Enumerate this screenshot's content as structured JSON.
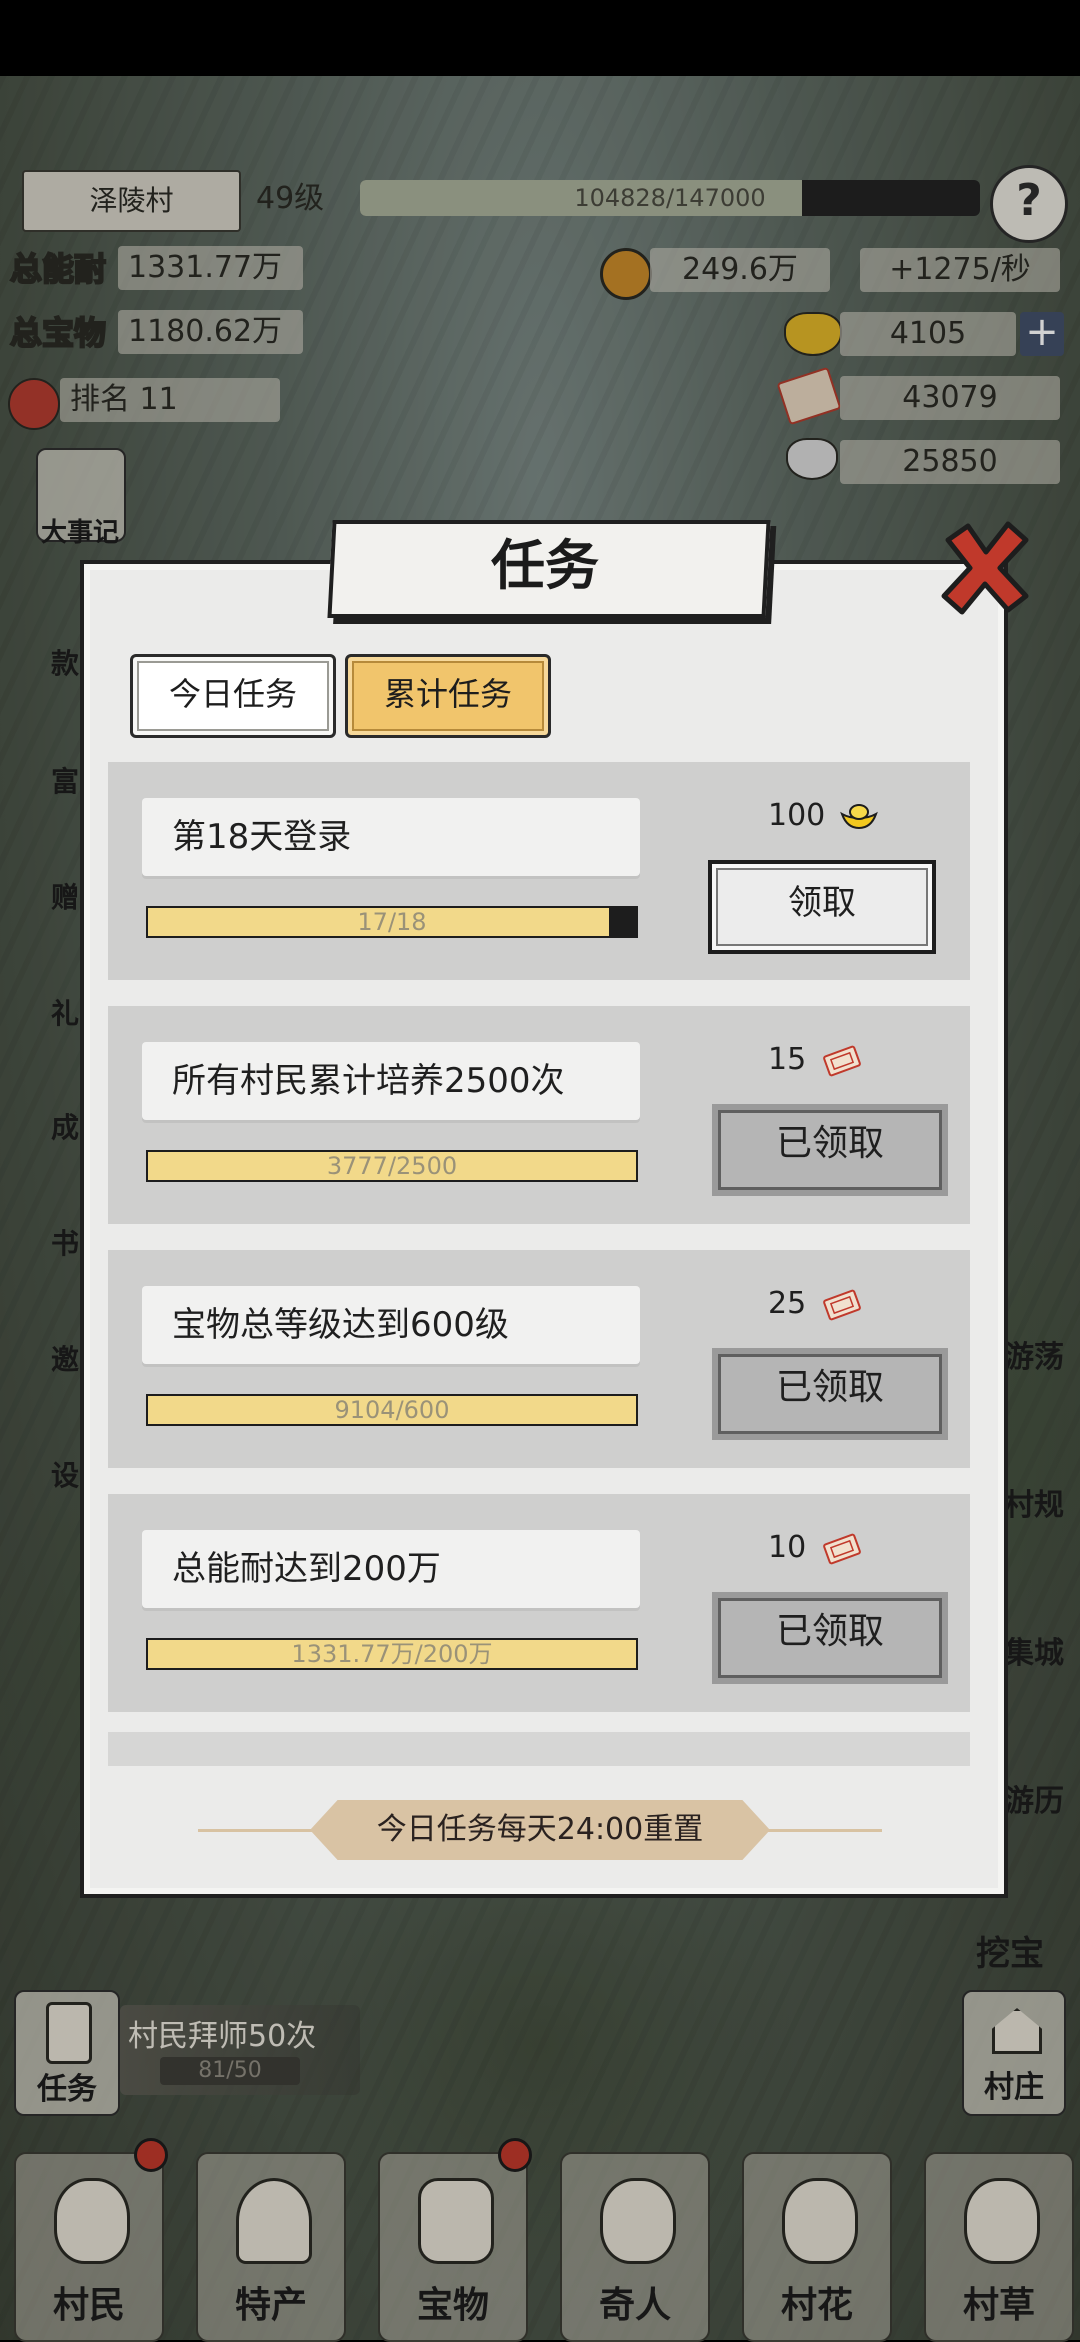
{
  "hud": {
    "village": "泽陵村",
    "level": "49级",
    "xp": "104828/147000",
    "xp_progress": 0.713,
    "help": "?",
    "total_endurance_label": "总能耐",
    "total_endurance": "1331.77万",
    "total_wealth_label": "总宝物",
    "total_wealth": "1180.62万",
    "rank": "排名 11",
    "coins": "249.6万",
    "coins_rate": "+1275/秒",
    "gold_ingots": "4105",
    "tickets": "43079",
    "silver": "25850",
    "plus": "+"
  },
  "left_side": [
    "大事记",
    "款",
    "富",
    "赠",
    "礼",
    "成",
    "书",
    "邀",
    "设"
  ],
  "right_side": [
    "游荡",
    "村规",
    "集城",
    "游历",
    "挖宝"
  ],
  "dialog": {
    "title": "任务",
    "tabs": [
      "今日任务",
      "累计任务"
    ],
    "active_tab": 1,
    "tasks": [
      {
        "title": "第18天登录",
        "progress_text": "17/18",
        "progress": 0.944,
        "reward": "100",
        "reward_icon": "gold-ingot-icon",
        "button": "领取",
        "claimed": false
      },
      {
        "title": "所有村民累计培养2500次",
        "progress_text": "3777/2500",
        "progress": 1.0,
        "reward": "15",
        "reward_icon": "ticket-icon",
        "button": "已领取",
        "claimed": true
      },
      {
        "title": "宝物总等级达到600级",
        "progress_text": "9104/600",
        "progress": 1.0,
        "reward": "25",
        "reward_icon": "ticket-icon",
        "button": "已领取",
        "claimed": true
      },
      {
        "title": "总能耐达到200万",
        "progress_text": "1331.77万/200万",
        "progress": 1.0,
        "reward": "10",
        "reward_icon": "ticket-icon",
        "button": "已领取",
        "claimed": true
      }
    ],
    "footer": "今日任务每天24:00重置"
  },
  "quest_tracker": {
    "label": "任务",
    "text": "村民拜师50次",
    "progress": "81/50"
  },
  "right_bottom": {
    "label": "村庄"
  },
  "bottom_nav": [
    "村民",
    "特产",
    "宝物",
    "奇人",
    "村花",
    "村草"
  ],
  "colors": {
    "accent_gold": "#f1c56c",
    "progress_fill": "#f2d98a",
    "close_red": "#c0392b"
  }
}
